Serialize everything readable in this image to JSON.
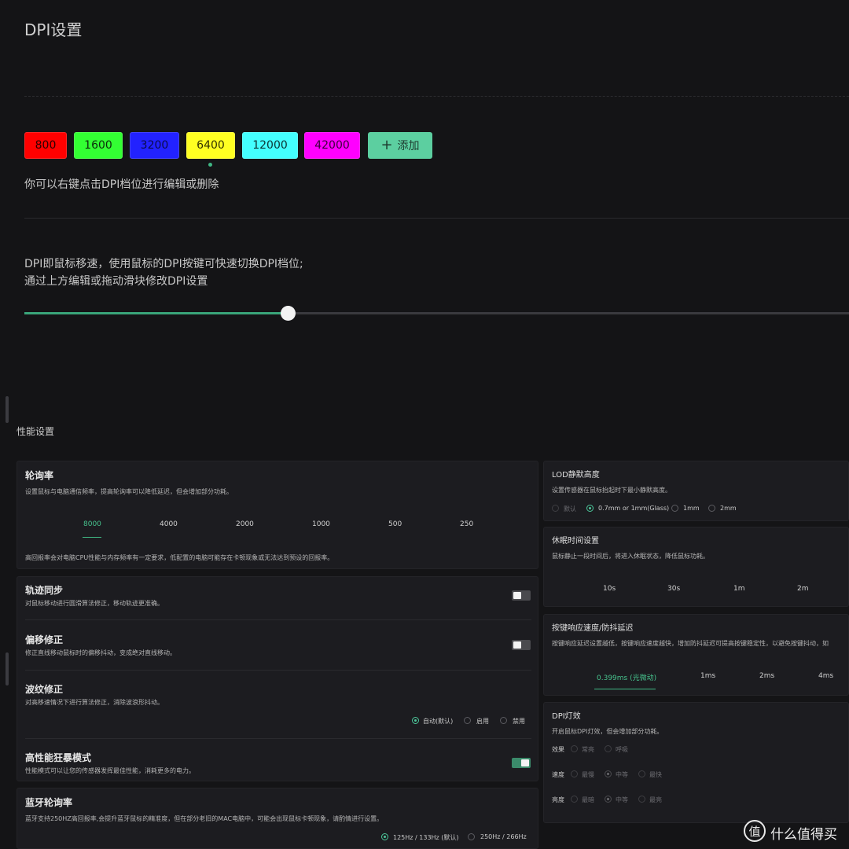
{
  "dpi": {
    "title": "DPI设置",
    "levels": [
      {
        "label": "800",
        "color": "#ff0000",
        "text_color": "#2a0000"
      },
      {
        "label": "1600",
        "color": "#33ff33",
        "text_color": "#0b2b0b"
      },
      {
        "label": "3200",
        "color": "#2222ff",
        "text_color": "#0a0a4a"
      },
      {
        "label": "6400",
        "color": "#ffff22",
        "text_color": "#333300"
      },
      {
        "label": "12000",
        "color": "#44ffff",
        "text_color": "#0c3333"
      },
      {
        "label": "42000",
        "color": "#ff00ff",
        "text_color": "#3a003a"
      }
    ],
    "active_level": "6400",
    "add_label": "添加",
    "hint": "你可以右键点击DPI档位进行编辑或删除",
    "desc_line1": "DPI即鼠标移速，使用鼠标的DPI按键可快速切换DPI档位;",
    "desc_line2": "通过上方编辑或拖动滑块修改DPI设置",
    "slider_fraction": 0.32
  },
  "performance": {
    "title": "性能设置",
    "polling": {
      "title": "轮询率",
      "desc": "设置鼠标与电脑通信频率，提高轮询率可以降低延迟，但会增加部分功耗。",
      "options": [
        "8000",
        "4000",
        "2000",
        "1000",
        "500",
        "250"
      ],
      "selected": "8000",
      "note": "高回报率会对电脑CPU性能与内存频率有一定要求，低配置的电脑可能存在卡顿现象或无法达到预设的回报率。"
    },
    "trajectory": {
      "title": "轨迹同步",
      "desc": "对鼠标移动进行圆滑算法修正，移动轨迹更准确。",
      "enabled": false
    },
    "offset": {
      "title": "偏移修正",
      "desc": "修正直线移动鼠标时的偏移抖动，变成绝对直线移动。",
      "enabled": false
    },
    "ripple": {
      "title": "波纹修正",
      "desc": "对高移速情况下进行算法修正，消除波浪形抖动。",
      "options": [
        "自动(默认)",
        "启用",
        "禁用"
      ],
      "selected": "自动(默认)"
    },
    "boost": {
      "title": "高性能狂暴模式",
      "desc": "性能模式可以让您的传感器发挥最佳性能，消耗更多的电力。",
      "enabled": true
    },
    "bt_polling": {
      "title": "蓝牙轮询率",
      "desc": "蓝牙支持250HZ高回报率,会提升蓝牙鼠标的精准度，但在部分老旧的MAC电脑中，可能会出现鼠标卡顿现象，请酌情进行设置。",
      "options": [
        "125Hz / 133Hz (默认)",
        "250Hz / 266Hz"
      ],
      "selected": "125Hz / 133Hz (默认)"
    },
    "lod": {
      "title": "LOD静默高度",
      "desc": "设置传感器在鼠标抬起时下最小静默高度。",
      "options": [
        "默认",
        "0.7mm or 1mm(Glass)",
        "1mm",
        "2mm"
      ],
      "selected": "0.7mm or 1mm(Glass)",
      "disabled": [
        "默认"
      ]
    },
    "sleep": {
      "title": "休眠时间设置",
      "desc": "鼠标静止一段时间后，将进入休眠状态，降低鼠标功耗。",
      "options": [
        "10s",
        "30s",
        "1m",
        "2m"
      ]
    },
    "debounce": {
      "title": "按键响应速度/防抖延迟",
      "desc": "按键响应延迟设置越低，按键响应速度越快，增加防抖延迟可提高按键稳定性，以避免按键抖动，如",
      "options": [
        "0.399ms (光微动)",
        "1ms",
        "2ms",
        "4ms"
      ],
      "selected": "0.399ms (光微动)"
    },
    "dpi_light": {
      "title": "DPI灯效",
      "desc": "开启鼠标DPI灯效，但会增加部分功耗。",
      "rows": [
        {
          "label": "效果",
          "options": [
            "常亮",
            "呼吸"
          ],
          "selected": ""
        },
        {
          "label": "速度",
          "options": [
            "最慢",
            "中等",
            "最快"
          ],
          "selected": "中等"
        },
        {
          "label": "亮度",
          "options": [
            "最暗",
            "中等",
            "最亮"
          ],
          "selected": "中等"
        }
      ]
    }
  },
  "watermark": {
    "icon_text": "值",
    "text": "什么值得买"
  }
}
